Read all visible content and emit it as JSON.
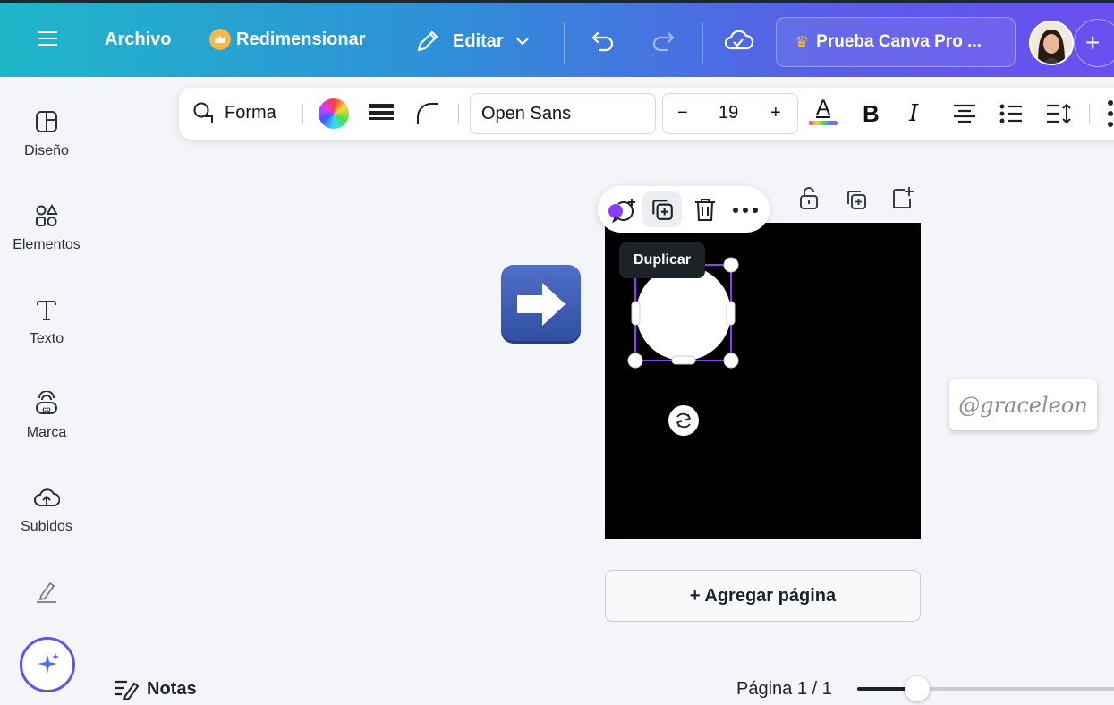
{
  "topbar": {
    "archivo": "Archivo",
    "redimensionar": "Redimensionar",
    "editar": "Editar",
    "trial_label": "Prueba Canva Pro ...",
    "plus": "+"
  },
  "sidebar": {
    "items": [
      {
        "label": "Diseño",
        "icon": "layout-icon"
      },
      {
        "label": "Elementos",
        "icon": "shapes-icon"
      },
      {
        "label": "Texto",
        "icon": "text-icon"
      },
      {
        "label": "Marca",
        "icon": "brand-icon"
      },
      {
        "label": "Subidos",
        "icon": "upload-cloud-icon"
      },
      {
        "label": "",
        "icon": "draw-icon"
      }
    ]
  },
  "toolbar": {
    "shape_label": "Forma",
    "font_name": "Open Sans",
    "font_size": "19",
    "minus": "−",
    "plus": "+",
    "text_color_letter": "A",
    "bold_letter": "B",
    "italic_letter": "I"
  },
  "context_menu": {
    "tooltip": "Duplicar"
  },
  "canvas": {
    "add_page": "+ Agregar página",
    "watermark": "@graceleon"
  },
  "footer": {
    "notes_label": "Notas",
    "page_indicator": "Página 1 / 1"
  },
  "colors": {
    "accent": "#6a4ff0",
    "page_bg": "#000000",
    "selection": "#8b3dff"
  }
}
